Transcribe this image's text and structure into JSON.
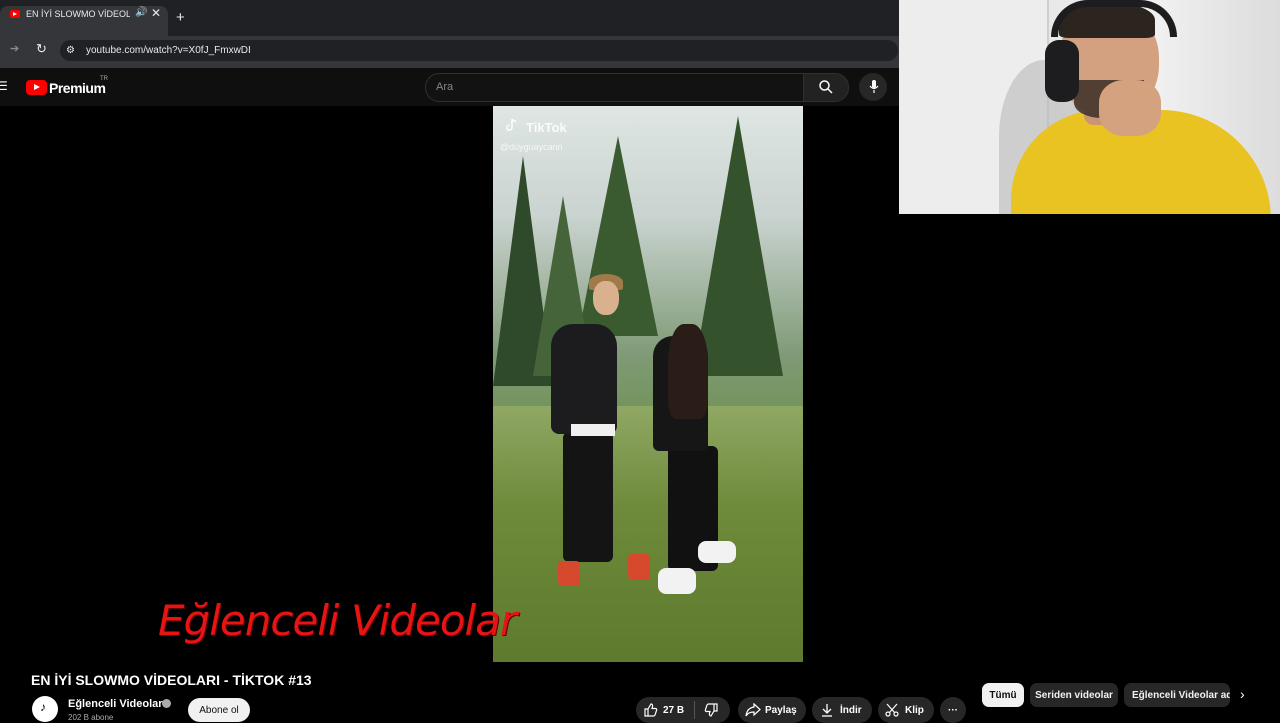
{
  "browser": {
    "tab_title": "EN İYİ SLOWMO VİDEOLARI",
    "new_tab": "+",
    "url": "youtube.com/watch?v=X0fJ_FmxwDI"
  },
  "youtube": {
    "brand": "Premium",
    "region": "TR",
    "search_placeholder": "Ara"
  },
  "video": {
    "tiktok_logo": "TikTok",
    "tiktok_user": "@duyguaycann",
    "watermark": "Eğlenceli Videolar",
    "title": "EN İYİ SLOWMO VİDEOLARI - TİKTOK #13"
  },
  "channel": {
    "name": "Eğlenceli Videolar",
    "subscribers": "202 B abone",
    "subscribe_label": "Abone ol"
  },
  "actions": {
    "likes": "27 B",
    "share": "Paylaş",
    "download": "İndir",
    "clip": "Klip",
    "more": "···"
  },
  "chips": [
    "Tümü",
    "Seriden videolar",
    "Eğlenceli Videolar adl"
  ],
  "colors": {
    "youtube_red": "#ff0000",
    "watermark_red": "#e81414",
    "background": "#000000"
  }
}
